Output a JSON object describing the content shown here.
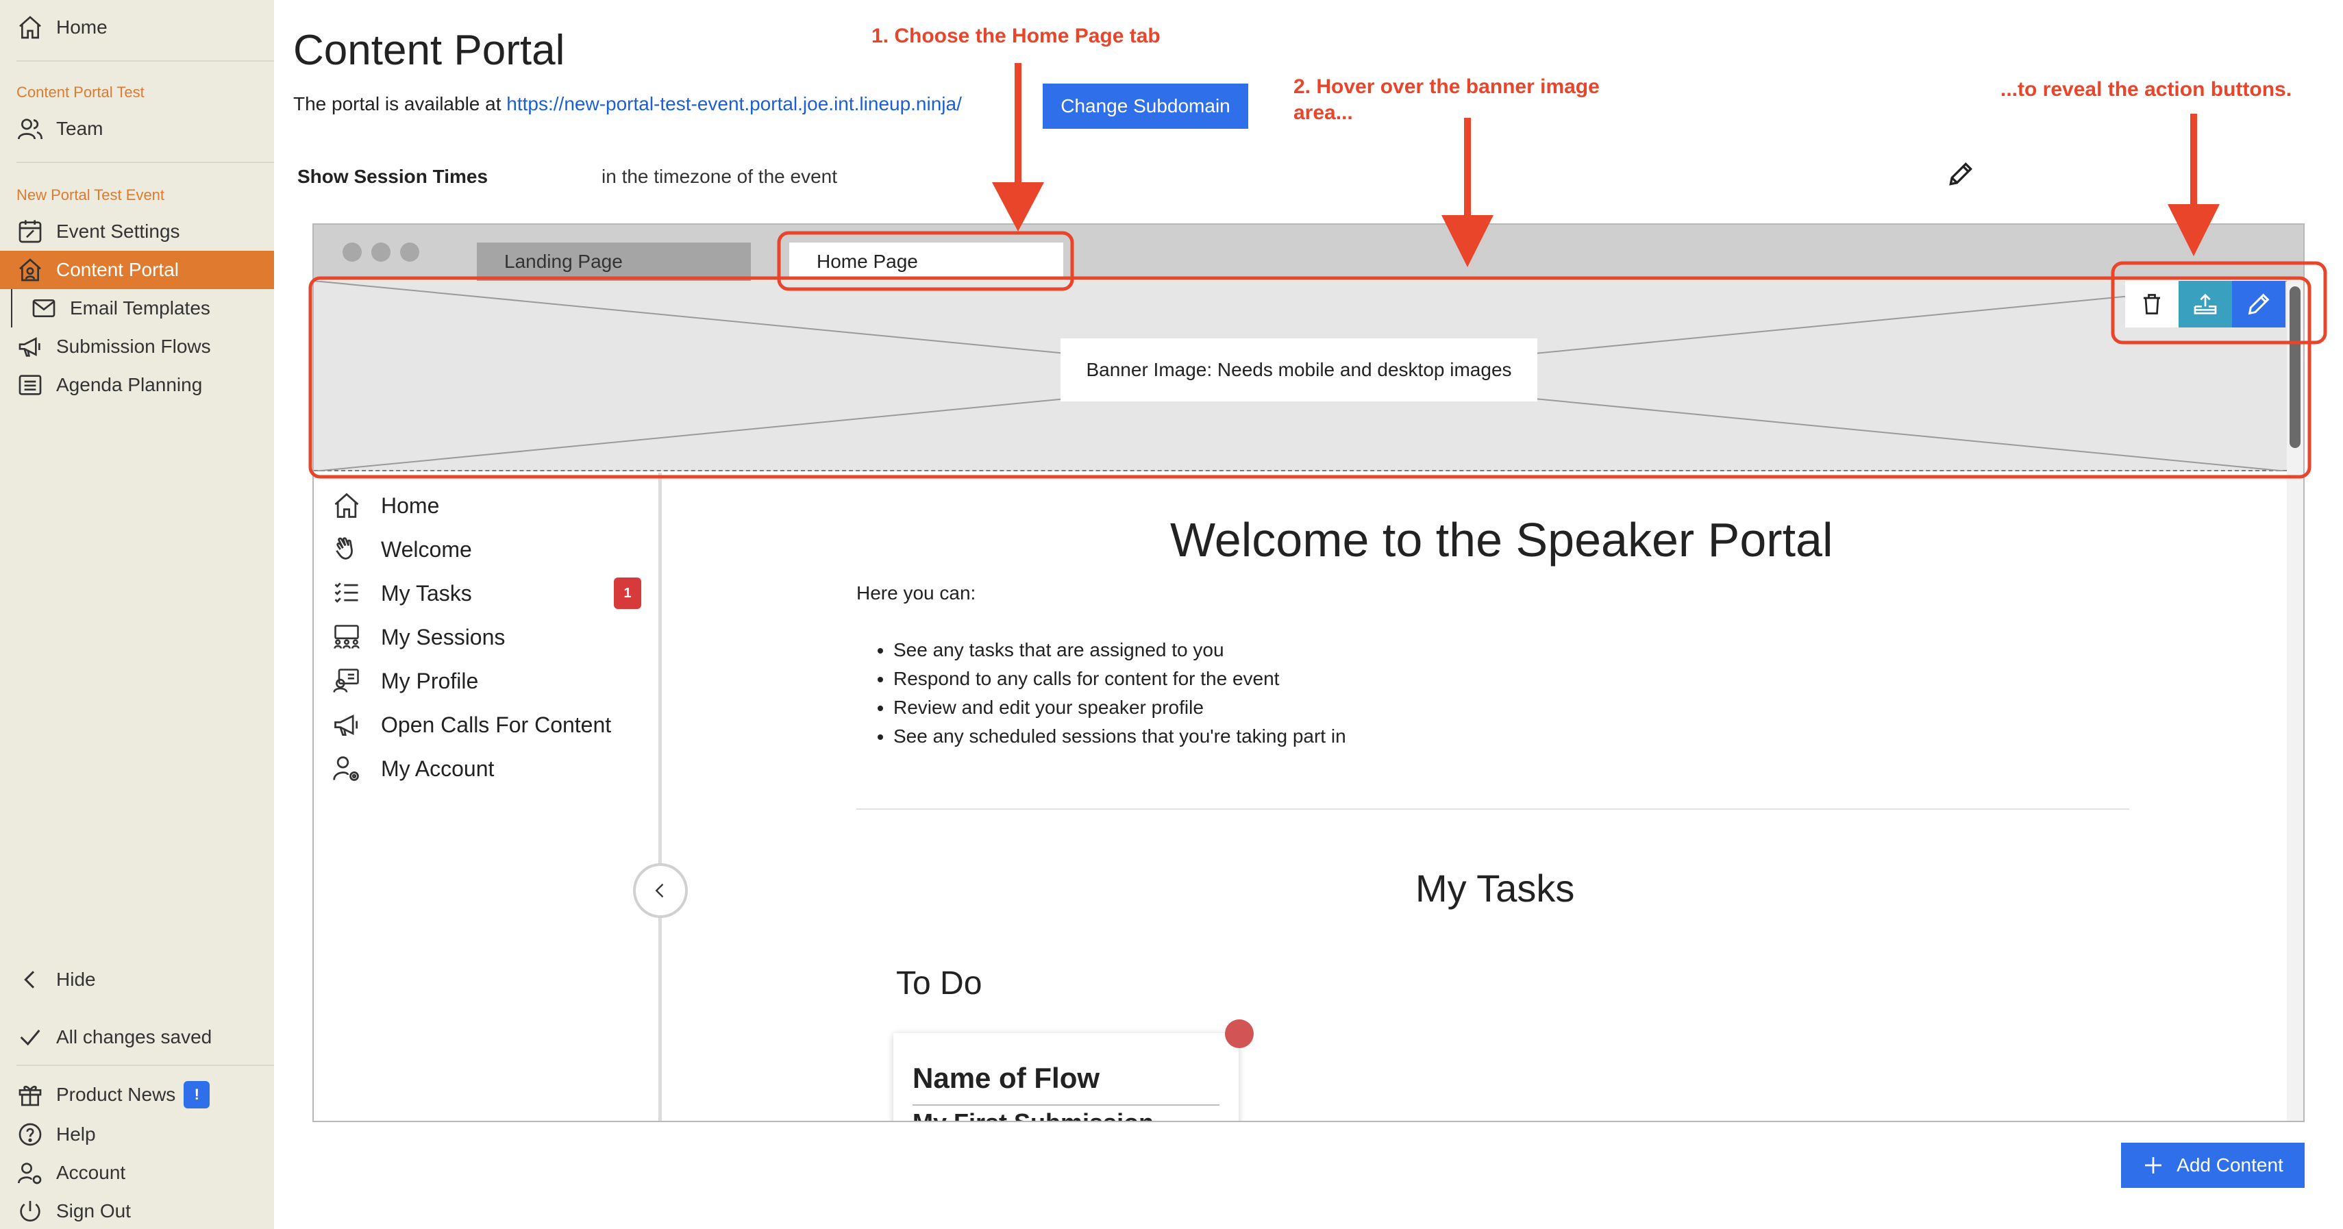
{
  "sidebar": {
    "home": "Home",
    "section1": "Content Portal Test",
    "team": "Team",
    "section2": "New Portal Test Event",
    "event_settings": "Event Settings",
    "content_portal": "Content Portal",
    "email_templates": "Email Templates",
    "submission_flows": "Submission Flows",
    "agenda_planning": "Agenda Planning",
    "hide": "Hide",
    "saved": "All changes saved",
    "product_news": "Product News",
    "product_news_badge": "!",
    "help": "Help",
    "account": "Account",
    "sign_out": "Sign Out"
  },
  "header": {
    "title": "Content Portal",
    "portal_prefix": "The portal is available at ",
    "portal_url": "https://new-portal-test-event.portal.joe.int.lineup.ninja/",
    "change_subdomain": "Change Subdomain",
    "session_label": "Show Session Times",
    "session_value": "in the timezone of the event"
  },
  "annotations": {
    "step1": "1. Choose the Home Page tab",
    "step2_line1": "2. Hover over the banner image",
    "step2_line2": "area...",
    "step3": "...to reveal the action buttons."
  },
  "frame": {
    "tab_landing": "Landing Page",
    "tab_home": "Home Page",
    "banner_label": "Banner Image: Needs mobile and desktop images"
  },
  "portal_nav": {
    "items": [
      "Home",
      "Welcome",
      "My Tasks",
      "My Sessions",
      "My Profile",
      "Open Calls For Content",
      "My Account"
    ],
    "tasks_badge": "1"
  },
  "portal_content": {
    "welcome_title": "Welcome to the Speaker Portal",
    "intro": "Here you can:",
    "bullets": [
      "See any tasks that are assigned to you",
      "Respond to any calls for content for the event",
      "Review and edit your speaker profile",
      "See any scheduled sessions that you're taking part in"
    ],
    "tasks_title": "My Tasks",
    "todo_title": "To Do",
    "flow_title": "Name of Flow",
    "flow_sub": "My First Submission"
  },
  "footer": {
    "add_content": "Add Content"
  },
  "colors": {
    "accent": "#e07a2e",
    "primary_blue": "#2f6fea",
    "annotation_red": "#e8452b",
    "sidebar_bg": "#ecebde"
  }
}
